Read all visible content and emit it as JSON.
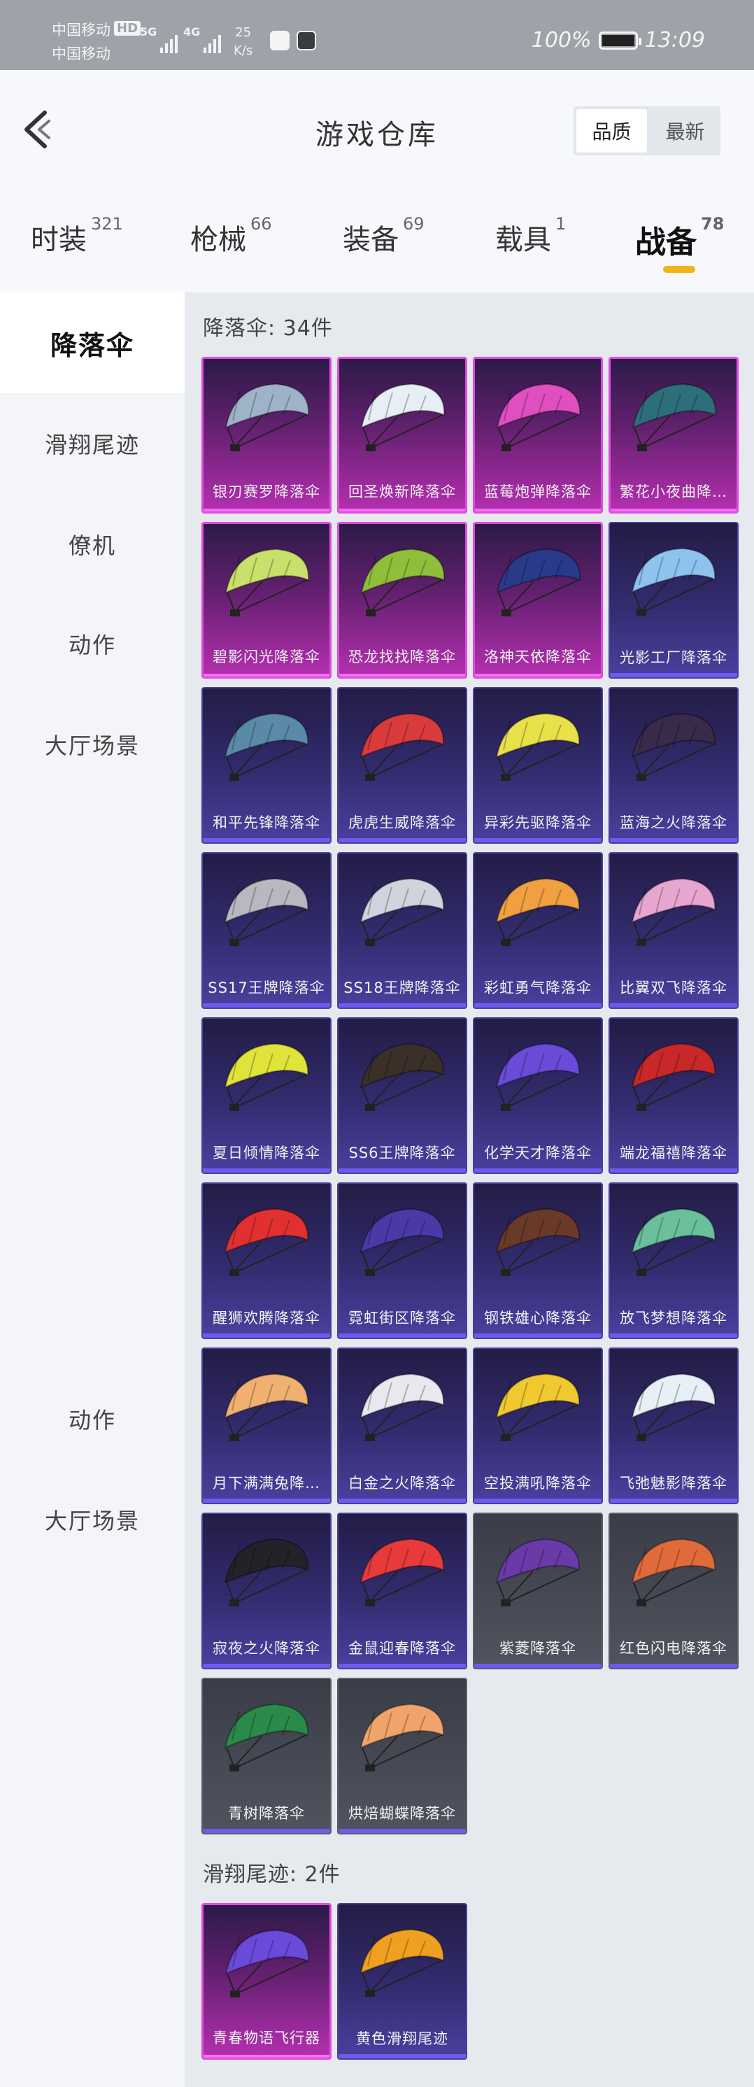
{
  "status_bar": {
    "carrier1": "中国移动",
    "carrier2": "中国移动",
    "hd": "HD",
    "sig1": "5G",
    "sig2": "4G",
    "speed_value": "25",
    "speed_unit": "K/s",
    "battery": "100%",
    "time": "13:09"
  },
  "header": {
    "title": "游戏仓库",
    "sort_options": [
      "品质",
      "最新"
    ],
    "sort_selected": "品质"
  },
  "tabs": [
    {
      "label": "时装",
      "count": "321"
    },
    {
      "label": "枪械",
      "count": "66"
    },
    {
      "label": "装备",
      "count": "69"
    },
    {
      "label": "载具",
      "count": "1"
    },
    {
      "label": "战备",
      "count": "78"
    }
  ],
  "active_tab": "战备",
  "sidebar": [
    {
      "label": "降落伞",
      "active": true
    },
    {
      "label": "滑翔尾迹",
      "active": false
    },
    {
      "label": "僚机",
      "active": false
    },
    {
      "label": "动作",
      "active": false
    },
    {
      "label": "大厅场景",
      "active": false
    },
    {
      "label": "动作",
      "active": false
    },
    {
      "label": "大厅场景",
      "active": false
    }
  ],
  "sections": [
    {
      "heading": "降落伞: 34件",
      "items": [
        {
          "name": "银刃赛罗降落伞",
          "rarity": "purple",
          "color": "#9fb3c8"
        },
        {
          "name": "回圣焕新降落伞",
          "rarity": "purple",
          "color": "#e8eef5"
        },
        {
          "name": "蓝莓炮弹降落伞",
          "rarity": "purple",
          "color": "#e04fc0"
        },
        {
          "name": "繁花小夜曲降…",
          "rarity": "purple",
          "color": "#2c6f7a"
        },
        {
          "name": "碧影闪光降落伞",
          "rarity": "purple",
          "color": "#c9e06a"
        },
        {
          "name": "恐龙找找降落伞",
          "rarity": "purple",
          "color": "#8fbf3a"
        },
        {
          "name": "洛神天依降落伞",
          "rarity": "purple",
          "color": "#2a3a8a"
        },
        {
          "name": "光影工厂降落伞",
          "rarity": "blue",
          "color": "#8fc3ef"
        },
        {
          "name": "和平先锋降落伞",
          "rarity": "blue",
          "color": "#5a8aa8"
        },
        {
          "name": "虎虎生威降落伞",
          "rarity": "blue",
          "color": "#d93b3b"
        },
        {
          "name": "异彩先驱降落伞",
          "rarity": "blue",
          "color": "#e9e14a"
        },
        {
          "name": "蓝海之火降落伞",
          "rarity": "blue",
          "color": "#3a2a4a"
        },
        {
          "name": "SS17王牌降落伞",
          "rarity": "blue",
          "color": "#b8b8c0"
        },
        {
          "name": "SS18王牌降落伞",
          "rarity": "blue",
          "color": "#d0d4dc"
        },
        {
          "name": "彩虹勇气降落伞",
          "rarity": "blue",
          "color": "#f0a040"
        },
        {
          "name": "比翼双飞降落伞",
          "rarity": "blue",
          "color": "#e7a6cf"
        },
        {
          "name": "夏日倾情降落伞",
          "rarity": "blue",
          "color": "#e0e43a"
        },
        {
          "name": "SS6王牌降落伞",
          "rarity": "blue",
          "color": "#3a3028"
        },
        {
          "name": "化学天才降落伞",
          "rarity": "blue",
          "color": "#6a4ad8"
        },
        {
          "name": "端龙福禧降落伞",
          "rarity": "blue",
          "color": "#c82828"
        },
        {
          "name": "醒狮欢腾降落伞",
          "rarity": "blue",
          "color": "#e23030"
        },
        {
          "name": "霓虹街区降落伞",
          "rarity": "blue",
          "color": "#4a3aa8"
        },
        {
          "name": "钢铁雄心降落伞",
          "rarity": "blue",
          "color": "#6a3a28"
        },
        {
          "name": "放飞梦想降落伞",
          "rarity": "blue",
          "color": "#6ac09a"
        },
        {
          "name": "月下满满兔降…",
          "rarity": "blue",
          "color": "#f0b070"
        },
        {
          "name": "白金之火降落伞",
          "rarity": "blue",
          "color": "#e8e8ee"
        },
        {
          "name": "空投满吼降落伞",
          "rarity": "blue",
          "color": "#f0c830"
        },
        {
          "name": "飞弛魅影降落伞",
          "rarity": "blue",
          "color": "#e6f0f6"
        },
        {
          "name": "寂夜之火降落伞",
          "rarity": "blue",
          "color": "#222228"
        },
        {
          "name": "金鼠迎春降落伞",
          "rarity": "blue",
          "color": "#e83a3a"
        },
        {
          "name": "紫菱降落伞",
          "rarity": "gray",
          "color": "#6a3aa8"
        },
        {
          "name": "红色闪电降落伞",
          "rarity": "gray",
          "color": "#e06a3a"
        },
        {
          "name": "青树降落伞",
          "rarity": "gray",
          "color": "#2a8a4a"
        },
        {
          "name": "烘焙蝴蝶降落伞",
          "rarity": "gray",
          "color": "#f0a46a"
        }
      ]
    },
    {
      "heading": "滑翔尾迹: 2件",
      "items": [
        {
          "name": "青春物语飞行器",
          "rarity": "purple",
          "color": "#6a4ad8"
        },
        {
          "name": "黄色滑翔尾迹",
          "rarity": "blue",
          "color": "#f0a020"
        }
      ]
    }
  ]
}
